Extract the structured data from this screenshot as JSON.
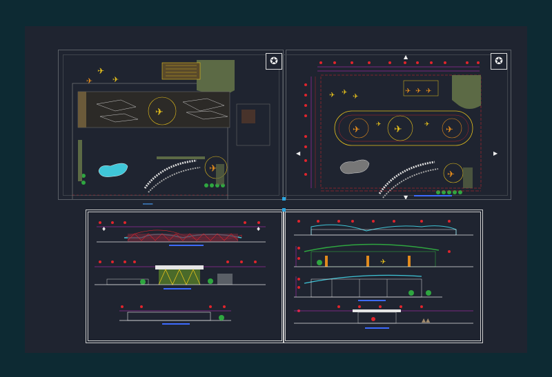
{
  "app": {
    "canvas_background": "#1f2430",
    "outer_background": "#0d2a33"
  },
  "sheets": {
    "site_plan": {
      "logo_icon": "✪"
    },
    "ground_floor_plan": {
      "logo_icon": "✪"
    },
    "elevations": {},
    "sections": {}
  },
  "grips": {
    "color": "#2aa6e0"
  },
  "colors": {
    "red_dim": "#e0242c",
    "magenta": "#d12fd1",
    "green": "#2fa640",
    "yellow": "#e8c21c",
    "cyan": "#3fc6d8",
    "white": "#e6e6e6",
    "orange": "#e08a1c",
    "blue": "#3d6bff"
  }
}
